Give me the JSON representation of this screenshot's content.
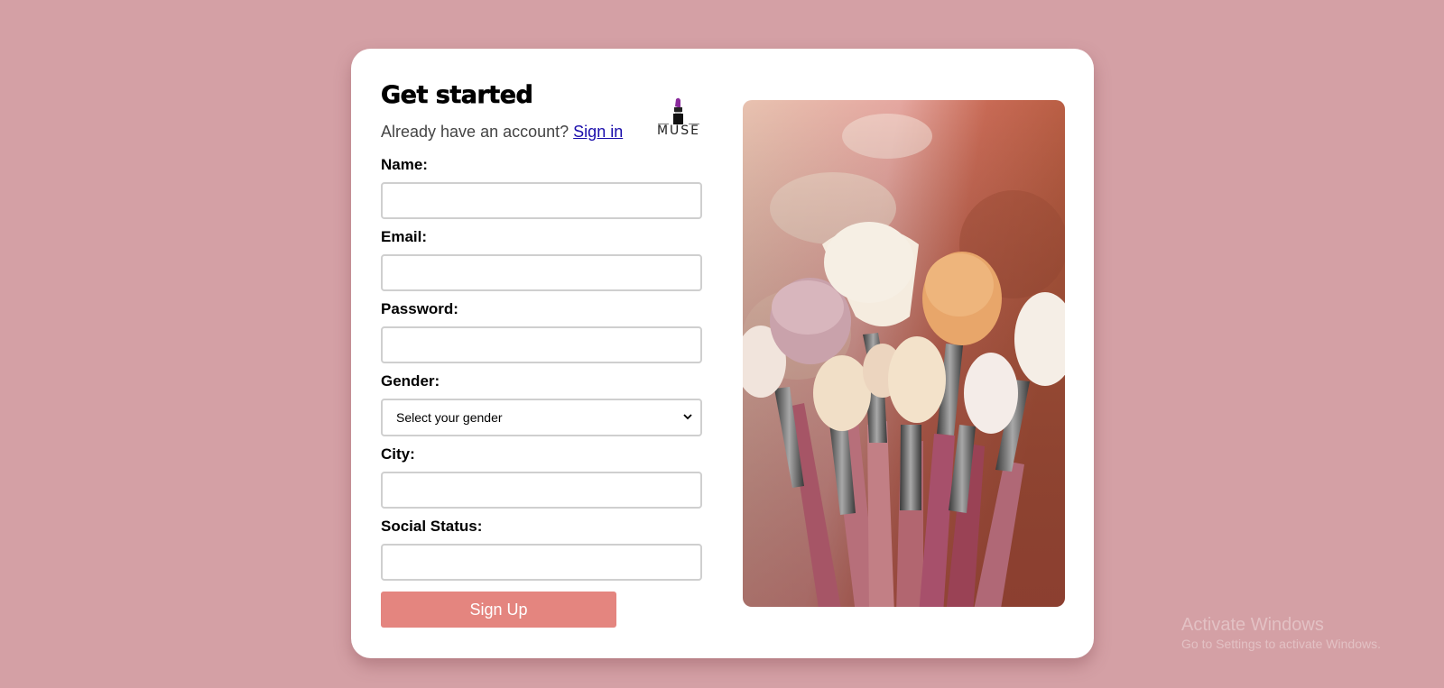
{
  "header": {
    "title": "Get started",
    "signin_prompt": "Already have an account?",
    "signin_link": "Sign in"
  },
  "logo": {
    "text": "MUSE",
    "icon": "lipstick-icon"
  },
  "form": {
    "fields": [
      {
        "label": "Name:",
        "value": ""
      },
      {
        "label": "Email:",
        "value": ""
      },
      {
        "label": "Password:",
        "value": ""
      },
      {
        "label": "Gender:",
        "selected": "Select your gender"
      },
      {
        "label": "City:",
        "value": ""
      },
      {
        "label": "Social Status:",
        "value": ""
      }
    ],
    "submit_label": "Sign Up"
  },
  "image": {
    "subject": "makeup-brushes-photo"
  },
  "watermark": {
    "title": "Activate Windows",
    "subtitle": "Go to Settings to activate Windows."
  },
  "colors": {
    "background": "#d4a0a5",
    "card": "#ffffff",
    "button": "#e4857f",
    "link": "#1a0dab"
  }
}
